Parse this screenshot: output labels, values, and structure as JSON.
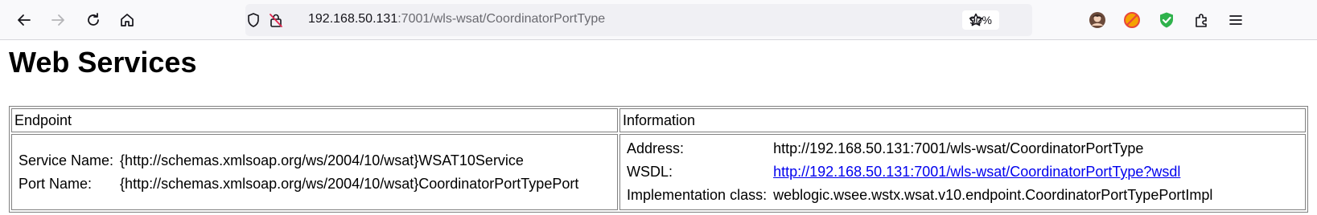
{
  "browser": {
    "url_host": "192.168.50.131",
    "url_path": ":7001/wls-wsat/CoordinatorPortType",
    "zoom": "90%",
    "icons": [
      "back-arrow-icon",
      "forward-arrow-icon",
      "reload-icon",
      "home-icon",
      "shield-icon",
      "insecure-lock-icon",
      "star-icon",
      "avatar-icon",
      "blocked-extension-icon",
      "check-shield-extension-icon",
      "extensions-icon",
      "menu-icon"
    ],
    "colors": {
      "ext_red": "#e8473a",
      "ext_orange": "#f6a200",
      "ext_green": "#2fb24c"
    }
  },
  "page": {
    "title": "Web Services",
    "headers": {
      "endpoint": "Endpoint",
      "information": "Information"
    },
    "endpoint": {
      "service_label": "Service Name:",
      "service_value": "{http://schemas.xmlsoap.org/ws/2004/10/wsat}WSAT10Service",
      "port_label": "Port Name:",
      "port_value": "{http://schemas.xmlsoap.org/ws/2004/10/wsat}CoordinatorPortTypePort"
    },
    "info": {
      "address_label": "Address:",
      "address_value": "http://192.168.50.131:7001/wls-wsat/CoordinatorPortType",
      "wsdl_label": "WSDL:",
      "wsdl_value": "http://192.168.50.131:7001/wls-wsat/CoordinatorPortType?wsdl",
      "impl_label": "Implementation class:",
      "impl_value": "weblogic.wsee.wstx.wsat.v10.endpoint.CoordinatorPortTypePortImpl"
    }
  }
}
